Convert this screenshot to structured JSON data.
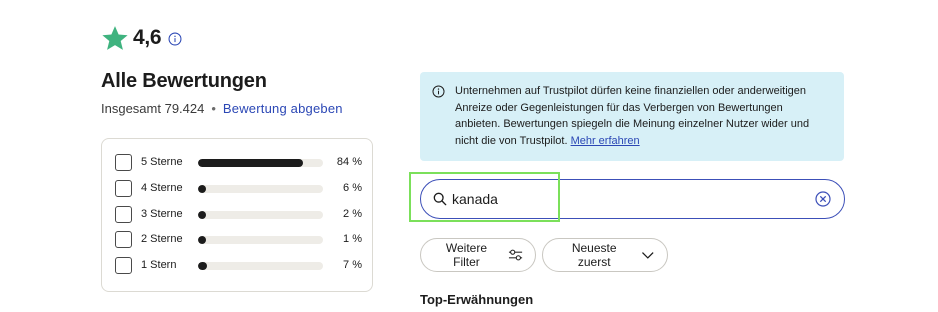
{
  "rating": {
    "value": "4,6",
    "star_color": "#3fb37f"
  },
  "reviews": {
    "title": "Alle Bewertungen",
    "total_label": "Insgesamt 79.424",
    "separator": "•",
    "write_review_link": "Bewertung abgeben"
  },
  "distribution": [
    {
      "label": "5 Sterne",
      "percent_text": "84 %",
      "percent": 84
    },
    {
      "label": "4 Sterne",
      "percent_text": "6 %",
      "percent": 6
    },
    {
      "label": "3 Sterne",
      "percent_text": "2 %",
      "percent": 2
    },
    {
      "label": "2 Sterne",
      "percent_text": "1 %",
      "percent": 1
    },
    {
      "label": "1 Stern",
      "percent_text": "7 %",
      "percent": 7
    }
  ],
  "notice": {
    "text": "Unternehmen auf Trustpilot dürfen keine finanziellen oder anderweitigen Anreize oder Gegenleistungen für das Verbergen von Bewertungen anbieten. Bewertungen spiegeln die Meinung einzelner Nutzer wider und nicht die von Trustpilot. ",
    "link": "Mehr erfahren",
    "background": "#d7f0f7"
  },
  "search": {
    "value": "kanada",
    "icon": "search-icon",
    "clear_icon": "close-circle-icon"
  },
  "filters": {
    "more_filters": "Weitere Filter",
    "sort": "Neueste zuerst"
  },
  "mentions_heading": "Top-Erwähnungen",
  "colors": {
    "accent": "#3c4fb8",
    "highlight": "#7be05a",
    "link": "#2b47b5"
  }
}
